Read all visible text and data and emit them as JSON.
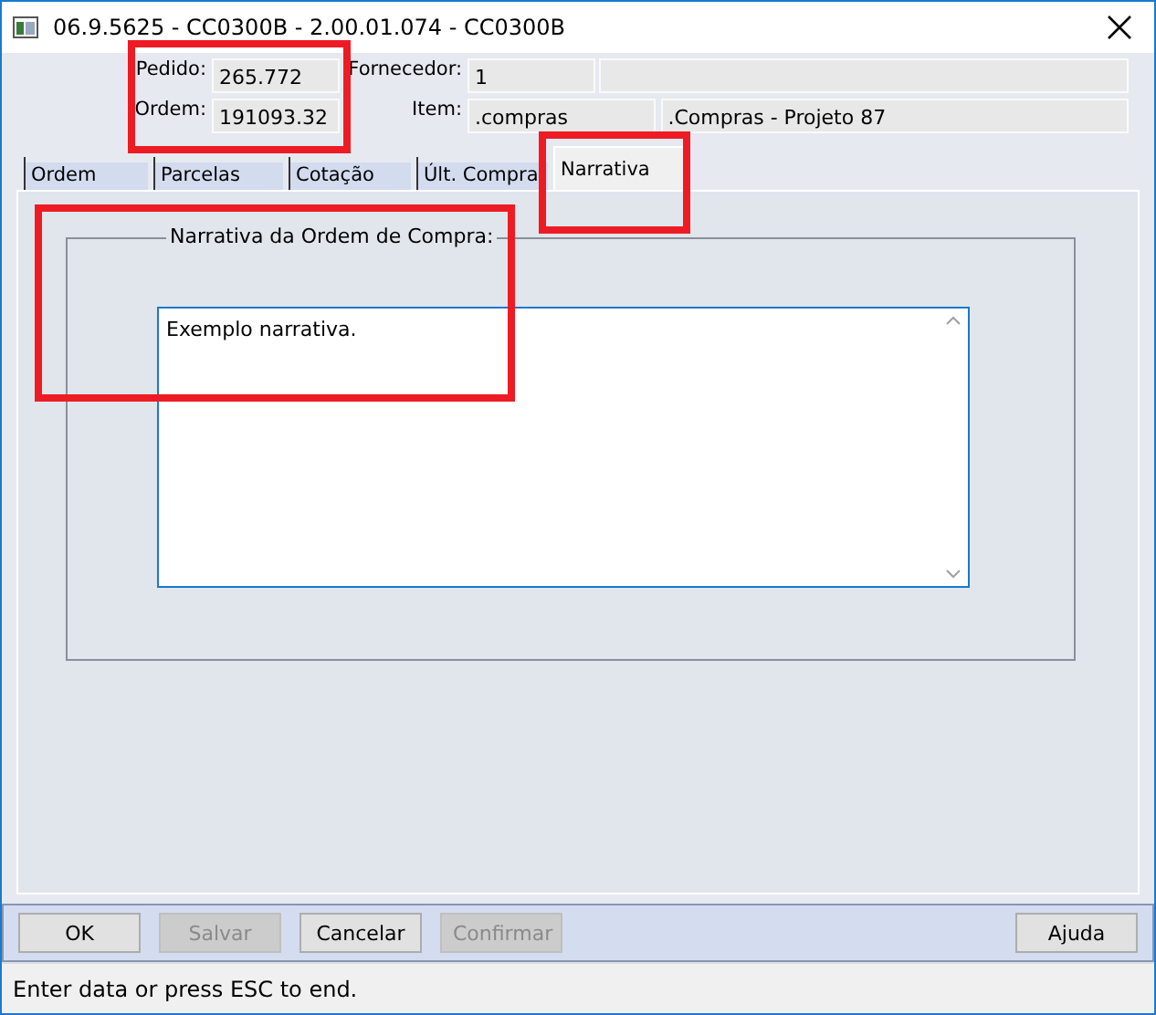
{
  "window": {
    "title": "06.9.5625 - CC0300B - 2.00.01.074 - CC0300B"
  },
  "header": {
    "fields": [
      {
        "label": "Pedido:",
        "value": "265.772"
      },
      {
        "label": "Fornecedor:",
        "value": "1"
      },
      {
        "label": "Ordem:",
        "value": "191093.32"
      },
      {
        "label": "Item:",
        "value": ".compras",
        "extra": ".Compras - Projeto 87"
      }
    ]
  },
  "tabs": [
    {
      "label": "Ordem",
      "selected": false
    },
    {
      "label": "Parcelas",
      "selected": false
    },
    {
      "label": "Cotação",
      "selected": false
    },
    {
      "label": "Últ. Compra",
      "selected": false
    },
    {
      "label": "Narrativa",
      "selected": true
    }
  ],
  "group": {
    "legend": "Narrativa da Ordem de Compra:",
    "text": "Exemplo narrativa."
  },
  "buttons": [
    {
      "label": "OK",
      "disabled": false
    },
    {
      "label": "Salvar",
      "disabled": true
    },
    {
      "label": "Cancelar",
      "disabled": false
    },
    {
      "label": "Confirmar",
      "disabled": true
    },
    {
      "label": "Ajuda",
      "disabled": false
    }
  ],
  "status_bar": "Enter data or press ESC to end."
}
